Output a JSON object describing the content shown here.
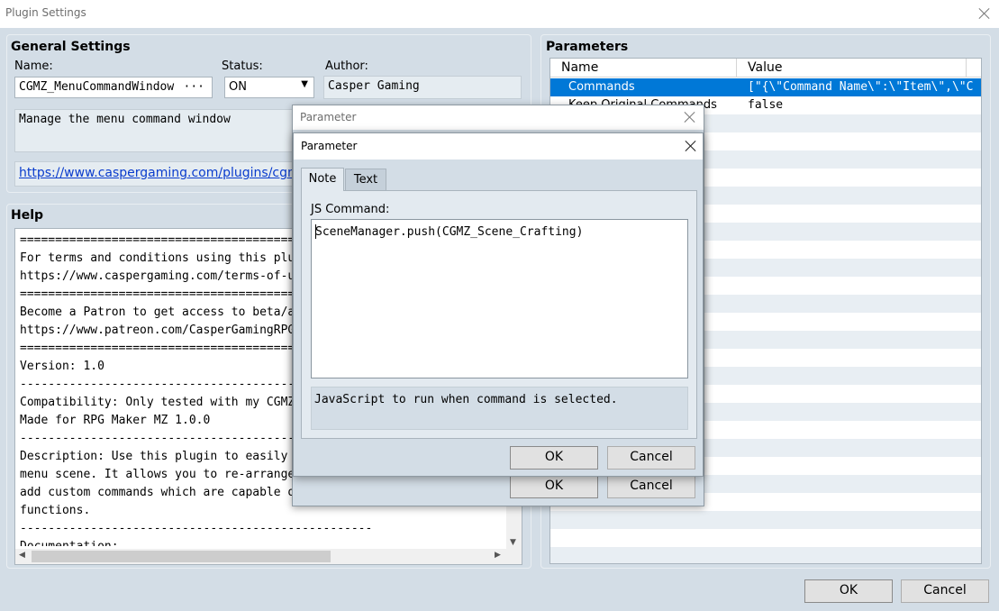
{
  "window": {
    "title": "Plugin Settings"
  },
  "general": {
    "heading": "General Settings",
    "name_label": "Name:",
    "name_value": "CGMZ_MenuCommandWindow",
    "name_more": "···",
    "status_label": "Status:",
    "status_value": "ON",
    "author_label": "Author:",
    "author_value": "Casper Gaming",
    "description": "Manage the menu command window",
    "url": "https://www.caspergaming.com/plugins/cgmz/"
  },
  "help": {
    "heading": "Help",
    "lines": [
      "==================================================",
      "For terms and conditions using this plugin",
      "https://www.caspergaming.com/terms-of-use/",
      "==================================================",
      "Become a Patron to get access to beta/alpha",
      "https://www.patreon.com/CasperGamingRPGM",
      "==================================================",
      "Version: 1.0",
      "--------------------------------------------------",
      "Compatibility: Only tested with my CGMZ plu",
      "Made for RPG Maker MZ 1.0.0",
      "--------------------------------------------------",
      "Description: Use this plugin to easily mana",
      "menu scene. It allows you to re-arrange com",
      "add custom commands which are capable of ca",
      "functions.",
      "--------------------------------------------------",
      "Documentation:"
    ]
  },
  "parameters": {
    "heading": "Parameters",
    "columns": [
      "Name",
      "Value"
    ],
    "rows": [
      {
        "name": "Commands",
        "value": "[\"{\\\"Command Name\\\":\\\"Item\\\",\\\"C…"
      },
      {
        "name": "Keep Original Commands",
        "value": "false"
      }
    ]
  },
  "footer": {
    "ok": "OK",
    "cancel": "Cancel"
  },
  "back_dialog": {
    "title": "Parameter",
    "ok": "OK",
    "cancel": "Cancel"
  },
  "front_dialog": {
    "title": "Parameter",
    "tabs": [
      "Note",
      "Text"
    ],
    "field_label": "JS Command:",
    "code": "SceneManager.push(CGMZ_Scene_Crafting)",
    "note": "JavaScript to run when command is selected.",
    "ok": "OK",
    "cancel": "Cancel"
  }
}
